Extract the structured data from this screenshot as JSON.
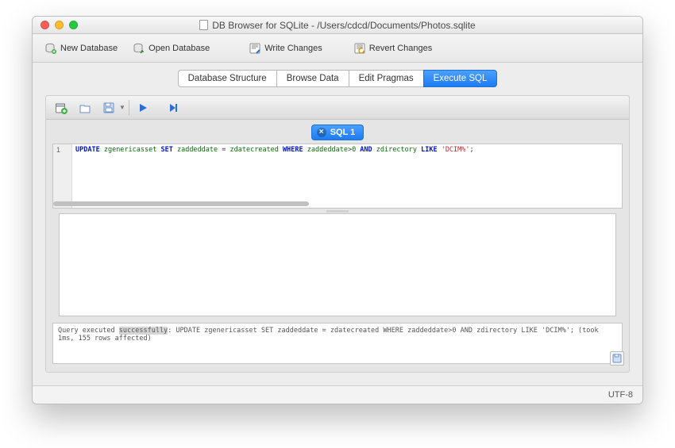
{
  "window": {
    "title": "DB Browser for SQLite - /Users/cdcd/Documents/Photos.sqlite"
  },
  "toolbar": {
    "new_database": "New Database",
    "open_database": "Open Database",
    "write_changes": "Write Changes",
    "revert_changes": "Revert Changes"
  },
  "tabs": {
    "items": [
      "Database Structure",
      "Browse Data",
      "Edit Pragmas",
      "Execute SQL"
    ],
    "active_index": 3
  },
  "exec_tab": {
    "label": "SQL 1"
  },
  "editor": {
    "line_number": "1",
    "sql": {
      "raw": "UPDATE zgenericasset SET zaddeddate = zdatecreated WHERE zaddeddate>0 AND zdirectory LIKE 'DCIM%';",
      "tokens": [
        {
          "t": "UPDATE",
          "c": "kw"
        },
        {
          "t": " zgenericasset ",
          "c": "ident"
        },
        {
          "t": "SET",
          "c": "kw"
        },
        {
          "t": " zaddeddate ",
          "c": "ident"
        },
        {
          "t": "=",
          "c": ""
        },
        {
          "t": " zdatecreated ",
          "c": "ident"
        },
        {
          "t": "WHERE",
          "c": "kw"
        },
        {
          "t": " zaddeddate",
          "c": "ident"
        },
        {
          "t": ">",
          "c": ""
        },
        {
          "t": "0",
          "c": "num"
        },
        {
          "t": " AND",
          "c": "kw"
        },
        {
          "t": " zdirectory ",
          "c": "ident"
        },
        {
          "t": "LIKE",
          "c": "kw"
        },
        {
          "t": " 'DCIM%'",
          "c": "str"
        },
        {
          "t": ";",
          "c": ""
        }
      ]
    }
  },
  "log": {
    "prefix": "Query executed ",
    "highlight": "successfully",
    "rest": ": UPDATE zgenericasset SET zaddeddate = zdatecreated WHERE zaddeddate>0 AND zdirectory LIKE 'DCIM%'; (took 1ms, 155 rows affected)"
  },
  "status": {
    "encoding": "UTF-8"
  },
  "colors": {
    "accent": "#1e7cf2"
  }
}
